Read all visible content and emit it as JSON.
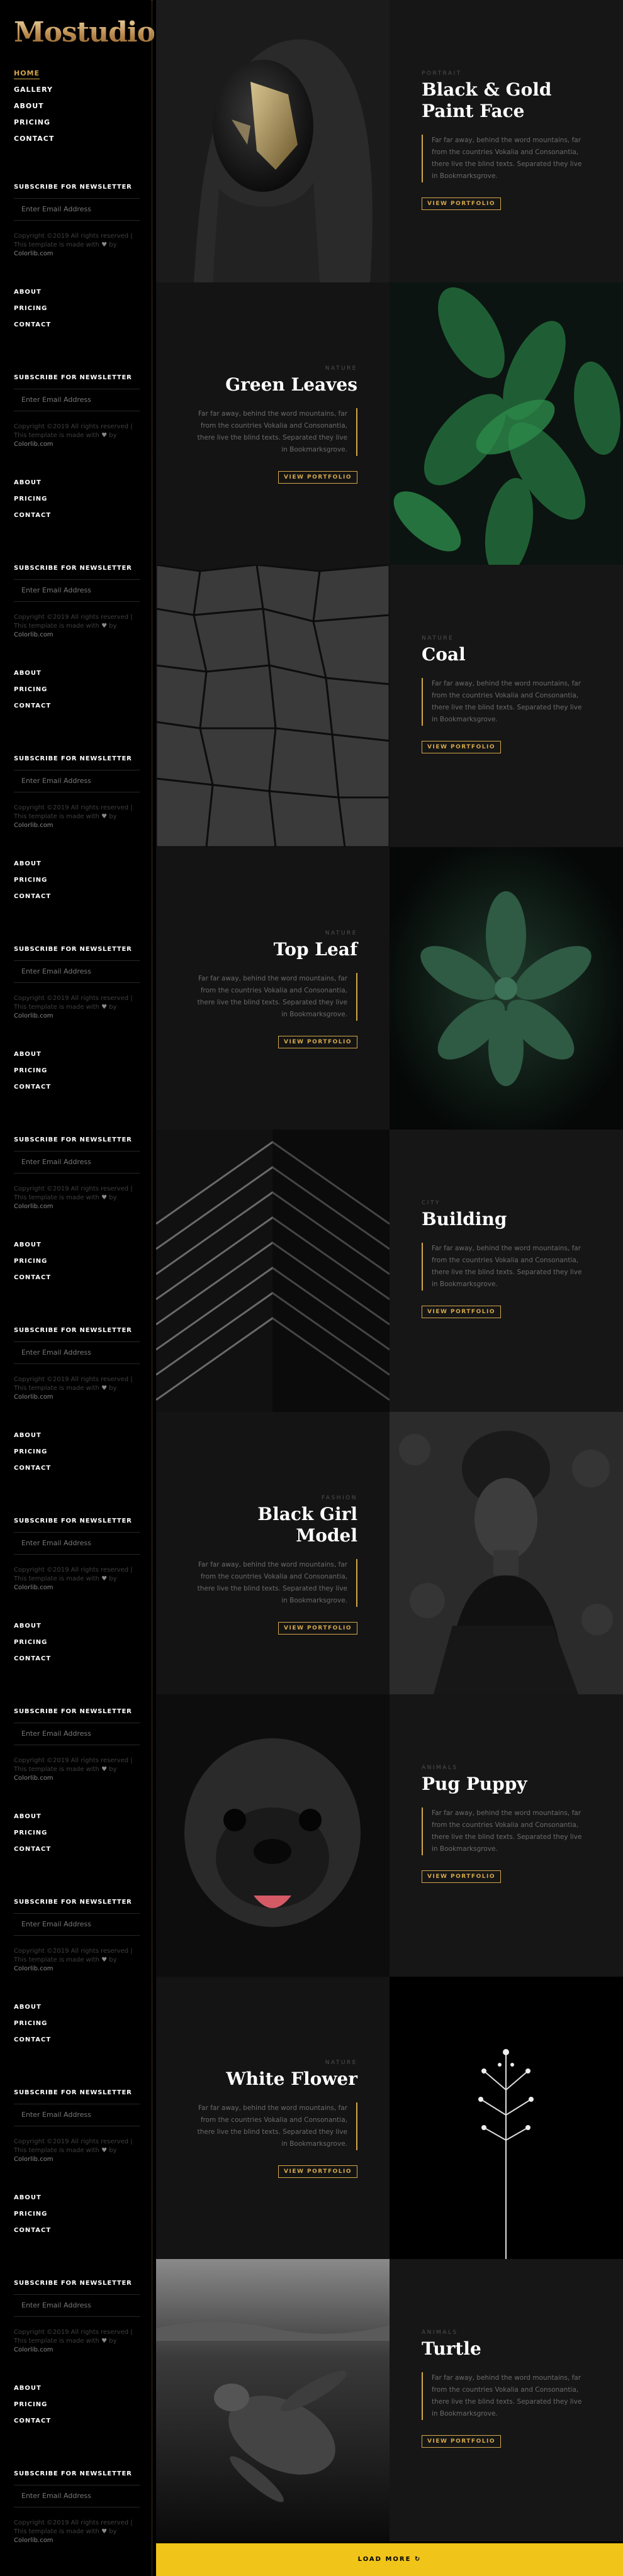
{
  "site": {
    "logo": "Mostudio"
  },
  "nav": [
    "HOME",
    "GALLERY",
    "ABOUT",
    "PRICING",
    "CONTACT"
  ],
  "mini_nav": [
    "ABOUT",
    "PRICING",
    "CONTACT"
  ],
  "newsletter": {
    "title": "SUBSCRIBE FOR NEWSLETTER",
    "placeholder": "Enter Email Address"
  },
  "copyright": {
    "line1": "Copyright ©2019 All rights reserved |",
    "line2": "This template is made with",
    "heart": "♥",
    "by": "by",
    "brand": "Colorlib.com"
  },
  "portfolio": [
    {
      "category": "PORTRAIT",
      "title": "Black & Gold Paint Face",
      "desc": "Far far away, behind the word mountains, far from the countries Vokalia and Consonantia, there live the blind texts. Separated they live in Bookmarksgrove.",
      "button": "VIEW PORTFOLIO"
    },
    {
      "category": "NATURE",
      "title": "Green Leaves",
      "desc": "Far far away, behind the word mountains, far from the countries Vokalia and Consonantia, there live the blind texts. Separated they live in Bookmarksgrove.",
      "button": "VIEW PORTFOLIO"
    },
    {
      "category": "NATURE",
      "title": "Coal",
      "desc": "Far far away, behind the word mountains, far from the countries Vokalia and Consonantia, there live the blind texts. Separated they live in Bookmarksgrove.",
      "button": "VIEW PORTFOLIO"
    },
    {
      "category": "NATURE",
      "title": "Top Leaf",
      "desc": "Far far away, behind the word mountains, far from the countries Vokalia and Consonantia, there live the blind texts. Separated they live in Bookmarksgrove.",
      "button": "VIEW PORTFOLIO"
    },
    {
      "category": "CITY",
      "title": "Building",
      "desc": "Far far away, behind the word mountains, far from the countries Vokalia and Consonantia, there live the blind texts. Separated they live in Bookmarksgrove.",
      "button": "VIEW PORTFOLIO"
    },
    {
      "category": "FASHION",
      "title": "Black Girl Model",
      "desc": "Far far away, behind the word mountains, far from the countries Vokalia and Consonantia, there live the blind texts. Separated they live in Bookmarksgrove.",
      "button": "VIEW PORTFOLIO"
    },
    {
      "category": "ANIMALS",
      "title": "Pug Puppy",
      "desc": "Far far away, behind the word mountains, far from the countries Vokalia and Consonantia, there live the blind texts. Separated they live in Bookmarksgrove.",
      "button": "VIEW PORTFOLIO"
    },
    {
      "category": "NATURE",
      "title": "White Flower",
      "desc": "Far far away, behind the word mountains, far from the countries Vokalia and Consonantia, there live the blind texts. Separated they live in Bookmarksgrove.",
      "button": "VIEW PORTFOLIO"
    },
    {
      "category": "ANIMALS",
      "title": "Turtle",
      "desc": "Far far away, behind the word mountains, far from the countries Vokalia and Consonantia, there live the blind texts. Separated they live in Bookmarksgrove.",
      "button": "VIEW PORTFOLIO"
    }
  ],
  "load_more": "LOAD MORE",
  "colors": {
    "accent": "#d4a84b",
    "load_more_bg": "#f0c419"
  },
  "icons": {
    "load_more": "refresh-icon"
  }
}
